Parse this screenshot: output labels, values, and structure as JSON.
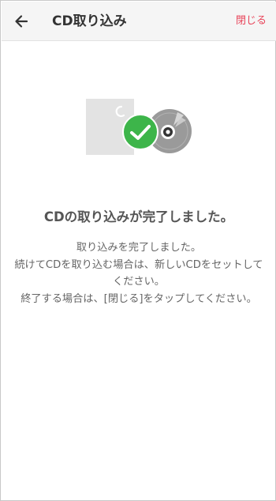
{
  "header": {
    "back_icon": "arrow-left-icon",
    "title": "CD取り込み",
    "close_label": "閉じる",
    "accent_color": "#e8455a"
  },
  "illustration": {
    "icons": [
      "cd-case-icon",
      "check-circle-icon",
      "disc-icon"
    ],
    "check_color": "#3db54a",
    "disc_color": "#9a9a9a"
  },
  "main": {
    "heading": "CDの取り込みが完了しました。",
    "description_lines": [
      "取り込みを完了しました。",
      "続けてCDを取り込む場合は、新しいCDをセットしてください。",
      "終了する場合は、[閉じる]をタップしてください。"
    ]
  }
}
